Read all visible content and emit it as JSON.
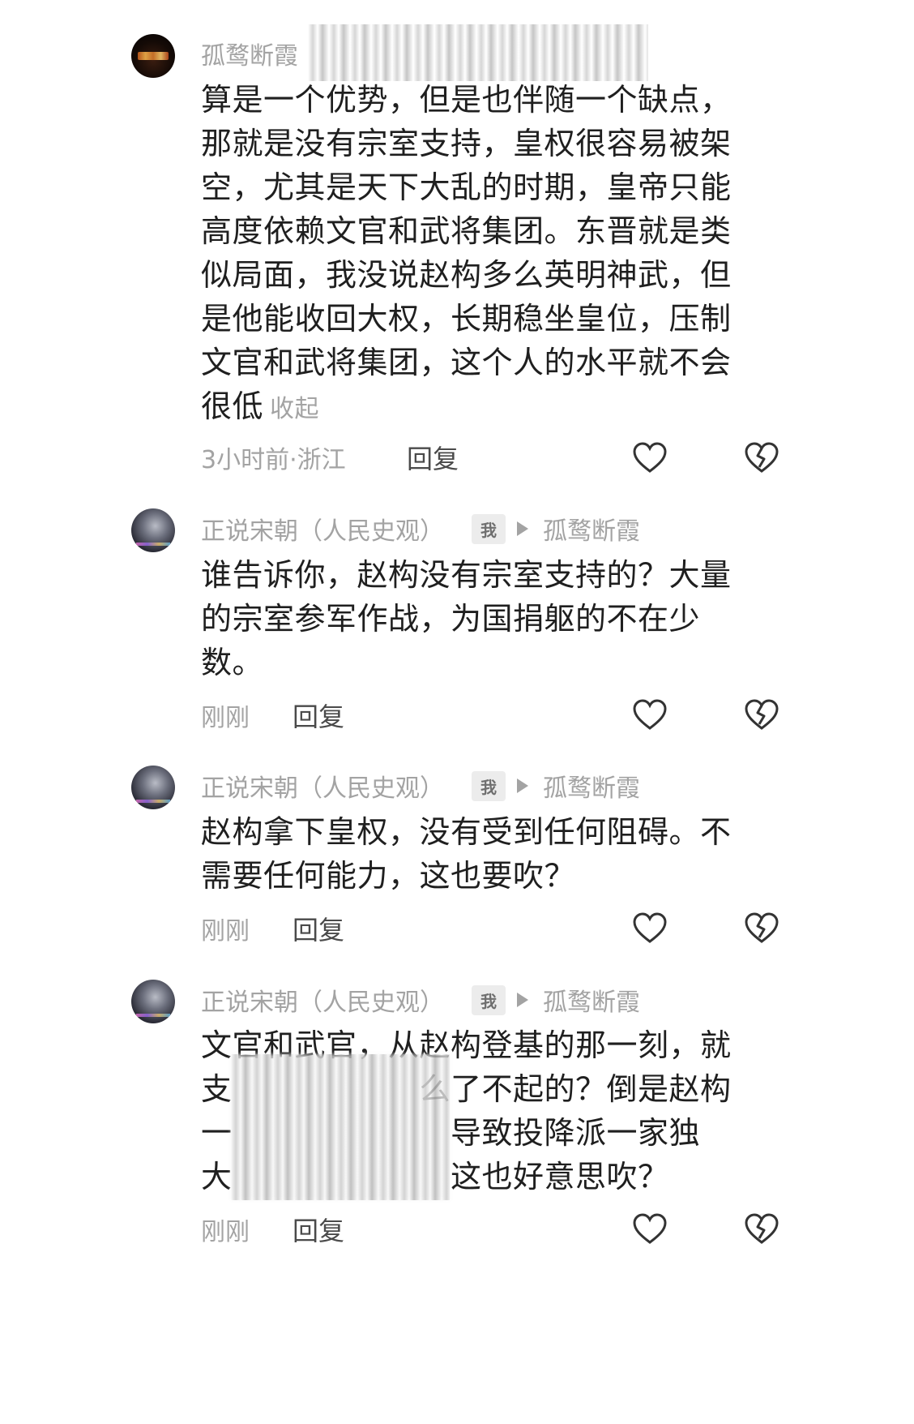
{
  "comments": [
    {
      "username": "孤鹜断霞",
      "body_lines": [
        "算是一个优势，但是也伴随一个缺点，",
        "那就是没有宗室支持，皇权很容易被架",
        "空，尤其是天下大乱的时期，皇帝只能",
        "高度依赖文官和武将集团。东晋就是类",
        "似局面，我没说赵构多么英明神武，但",
        "是他能收回大权，长期稳坐皇位，压制",
        "文官和武将集团，这个人的水平就不会",
        "很低"
      ],
      "collapse_label": "收起",
      "time": "3小时前·浙江",
      "reply_label": "回复"
    },
    {
      "username": "正说宋朝（人民史观）",
      "me_tag": "我",
      "reply_to": "孤鹜断霞",
      "body_lines": [
        "谁告诉你，赵构没有宗室支持的？大量",
        "的宗室参军作战，为国捐躯的不在少",
        "数。"
      ],
      "time": "刚刚",
      "reply_label": "回复"
    },
    {
      "username": "正说宋朝（人民史观）",
      "me_tag": "我",
      "reply_to": "孤鹜断霞",
      "body_lines": [
        "赵构拿下皇权，没有受到任何阻碍。不",
        "需要任何能力，这也要吹？"
      ],
      "time": "刚刚",
      "reply_label": "回复"
    },
    {
      "username": "正说宋朝（人民史观）",
      "me_tag": "我",
      "reply_to": "孤鹜断霞",
      "body_lines": [
        "文官和武官，从赵构登基的那一刻，就",
        "支　　　　　　么了不起的？倒是赵构",
        "一　　　　　　　导致投降派一家独",
        "大　　　　　　　这也好意思吹？"
      ],
      "time": "刚刚",
      "reply_label": "回复"
    }
  ],
  "icons": {
    "like": "heart-outline-icon",
    "dislike": "broken-heart-outline-icon",
    "arrow": "play-arrow-icon"
  },
  "colors": {
    "text": "#1f1f1f",
    "meta": "#a3a3a3",
    "reply": "#4a4a4a",
    "icon": "#333333"
  }
}
